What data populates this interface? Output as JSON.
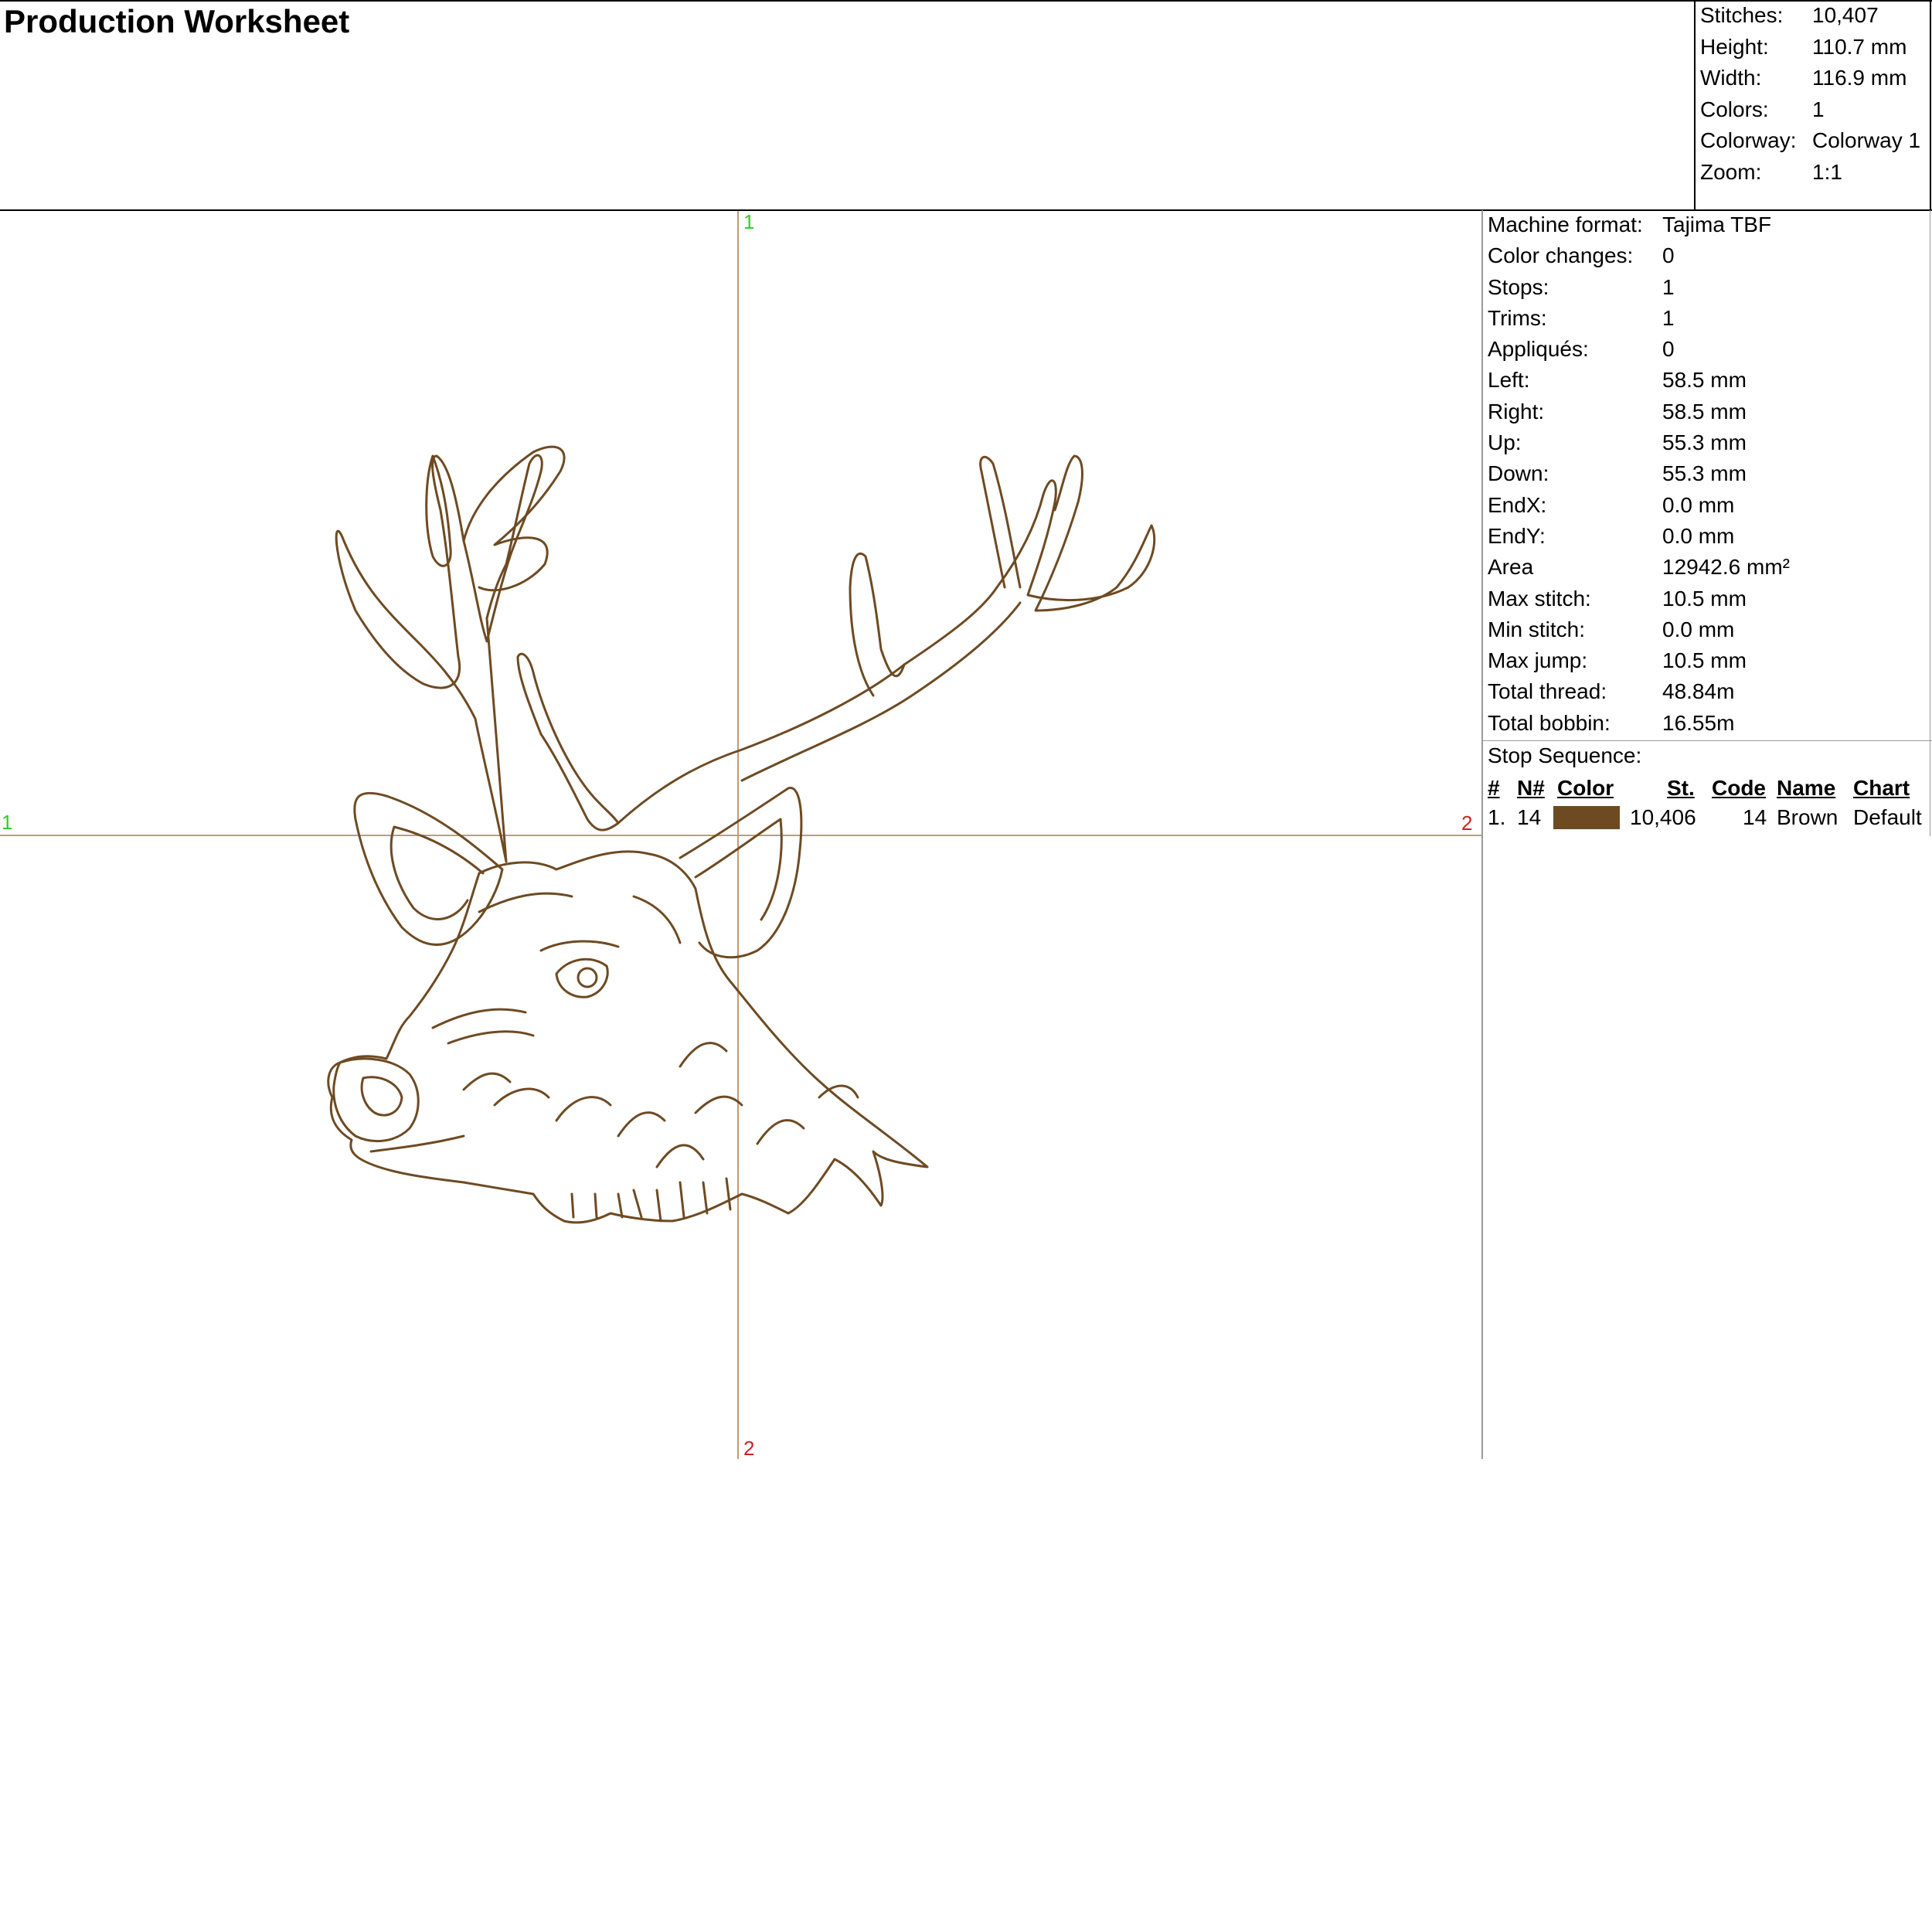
{
  "title": "Production Worksheet",
  "summary": [
    {
      "label": "Stitches:",
      "value": "10,407"
    },
    {
      "label": "Height:",
      "value": "110.7 mm"
    },
    {
      "label": "Width:",
      "value": "116.9 mm"
    },
    {
      "label": "Colors:",
      "value": "1"
    },
    {
      "label": "Colorway:",
      "value": "Colorway 1"
    },
    {
      "label": "Zoom:",
      "value": "1:1"
    }
  ],
  "stats": [
    {
      "label": "Machine format:",
      "value": "Tajima TBF"
    },
    {
      "label": "Color changes:",
      "value": "0"
    },
    {
      "label": "Stops:",
      "value": "1"
    },
    {
      "label": "Trims:",
      "value": "1"
    },
    {
      "label": "Appliqués:",
      "value": "0"
    },
    {
      "label": "Left:",
      "value": "58.5 mm"
    },
    {
      "label": "Right:",
      "value": "58.5 mm"
    },
    {
      "label": "Up:",
      "value": "55.3 mm"
    },
    {
      "label": "Down:",
      "value": "55.3 mm"
    },
    {
      "label": "EndX:",
      "value": "0.0 mm"
    },
    {
      "label": "EndY:",
      "value": "0.0 mm"
    },
    {
      "label": "Area",
      "value": "12942.6 mm²"
    },
    {
      "label": "Max stitch:",
      "value": "10.5 mm"
    },
    {
      "label": "Min stitch:",
      "value": "0.0 mm"
    },
    {
      "label": "Max jump:",
      "value": "10.5 mm"
    },
    {
      "label": "Total thread:",
      "value": "48.84m"
    },
    {
      "label": "Total bobbin:",
      "value": "16.55m"
    }
  ],
  "stop_sequence": {
    "title": "Stop Sequence:",
    "headers": {
      "num": "#",
      "n": "N#",
      "color": "Color",
      "st": "St.",
      "code": "Code",
      "name": "Name",
      "chart": "Chart"
    },
    "rows": [
      {
        "num": "1.",
        "n": "14",
        "color": "#6e4a22",
        "st": "10,406",
        "code": "14",
        "name": "Brown",
        "chart": "Default"
      }
    ]
  },
  "axes": {
    "top": "1",
    "left": "1",
    "right": "2",
    "bottom": "2",
    "start_color": "#33cc33",
    "end_color": "#cc2222",
    "guide_color": "#c89a6e"
  },
  "thread_color": "#6e4a22"
}
